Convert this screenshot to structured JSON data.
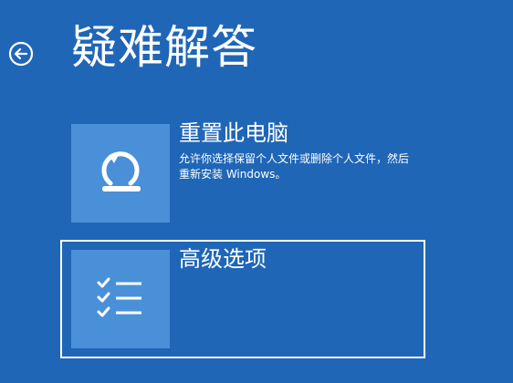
{
  "page": {
    "title": "疑难解答"
  },
  "options": {
    "reset": {
      "title": "重置此电脑",
      "description": "允许你选择保留个人文件或删除个人文件，然后重新安装 Windows。"
    },
    "advanced": {
      "title": "高级选项"
    }
  },
  "icons": {
    "back": "back-arrow-icon",
    "reset": "reset-pc-icon",
    "advanced": "checklist-icon"
  },
  "colors": {
    "background": "#1f66b7",
    "tile": "#4a90d8",
    "text": "#ffffff",
    "focus_border": "#ffffff"
  }
}
